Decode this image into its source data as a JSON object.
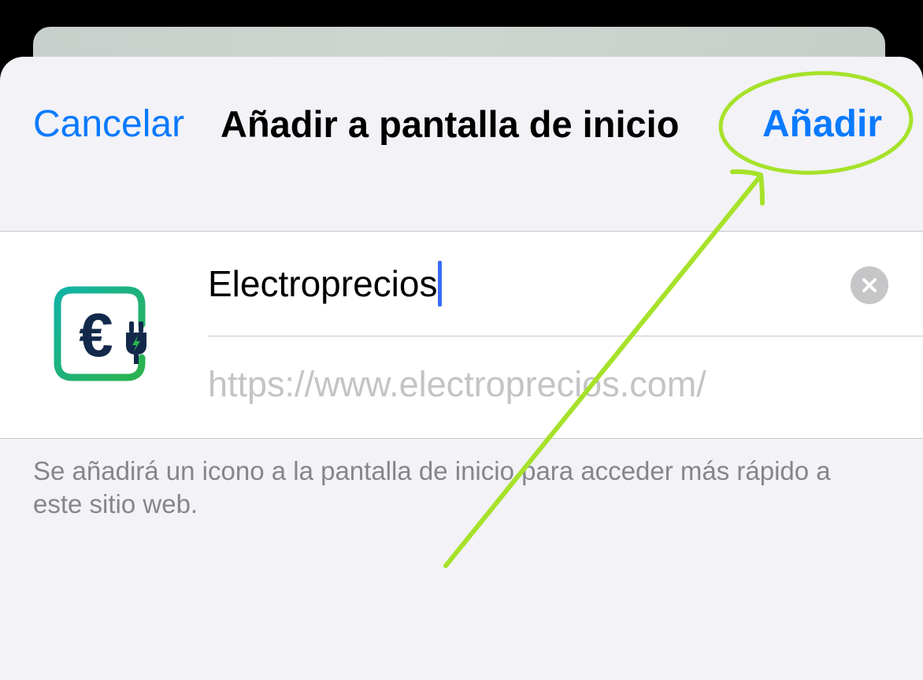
{
  "header": {
    "cancel_label": "Cancelar",
    "title": "Añadir a pantalla de inicio",
    "add_label": "Añadir"
  },
  "form": {
    "name_value": "Electroprecios",
    "url": "https://www.electroprecios.com/"
  },
  "footer": {
    "note": "Se añadirá un icono a la pantalla de inicio para acceder más rápido a este sitio web."
  },
  "icons": {
    "app_icon": "euro-plug-icon",
    "clear": "clear-x-icon"
  },
  "colors": {
    "accent": "#0a7aff",
    "sheet_bg": "#f2f2f7",
    "annotation": "#a6e22a",
    "icon_dark": "#13294b",
    "icon_teal": "#12b3a8",
    "icon_green": "#2bb24c"
  }
}
